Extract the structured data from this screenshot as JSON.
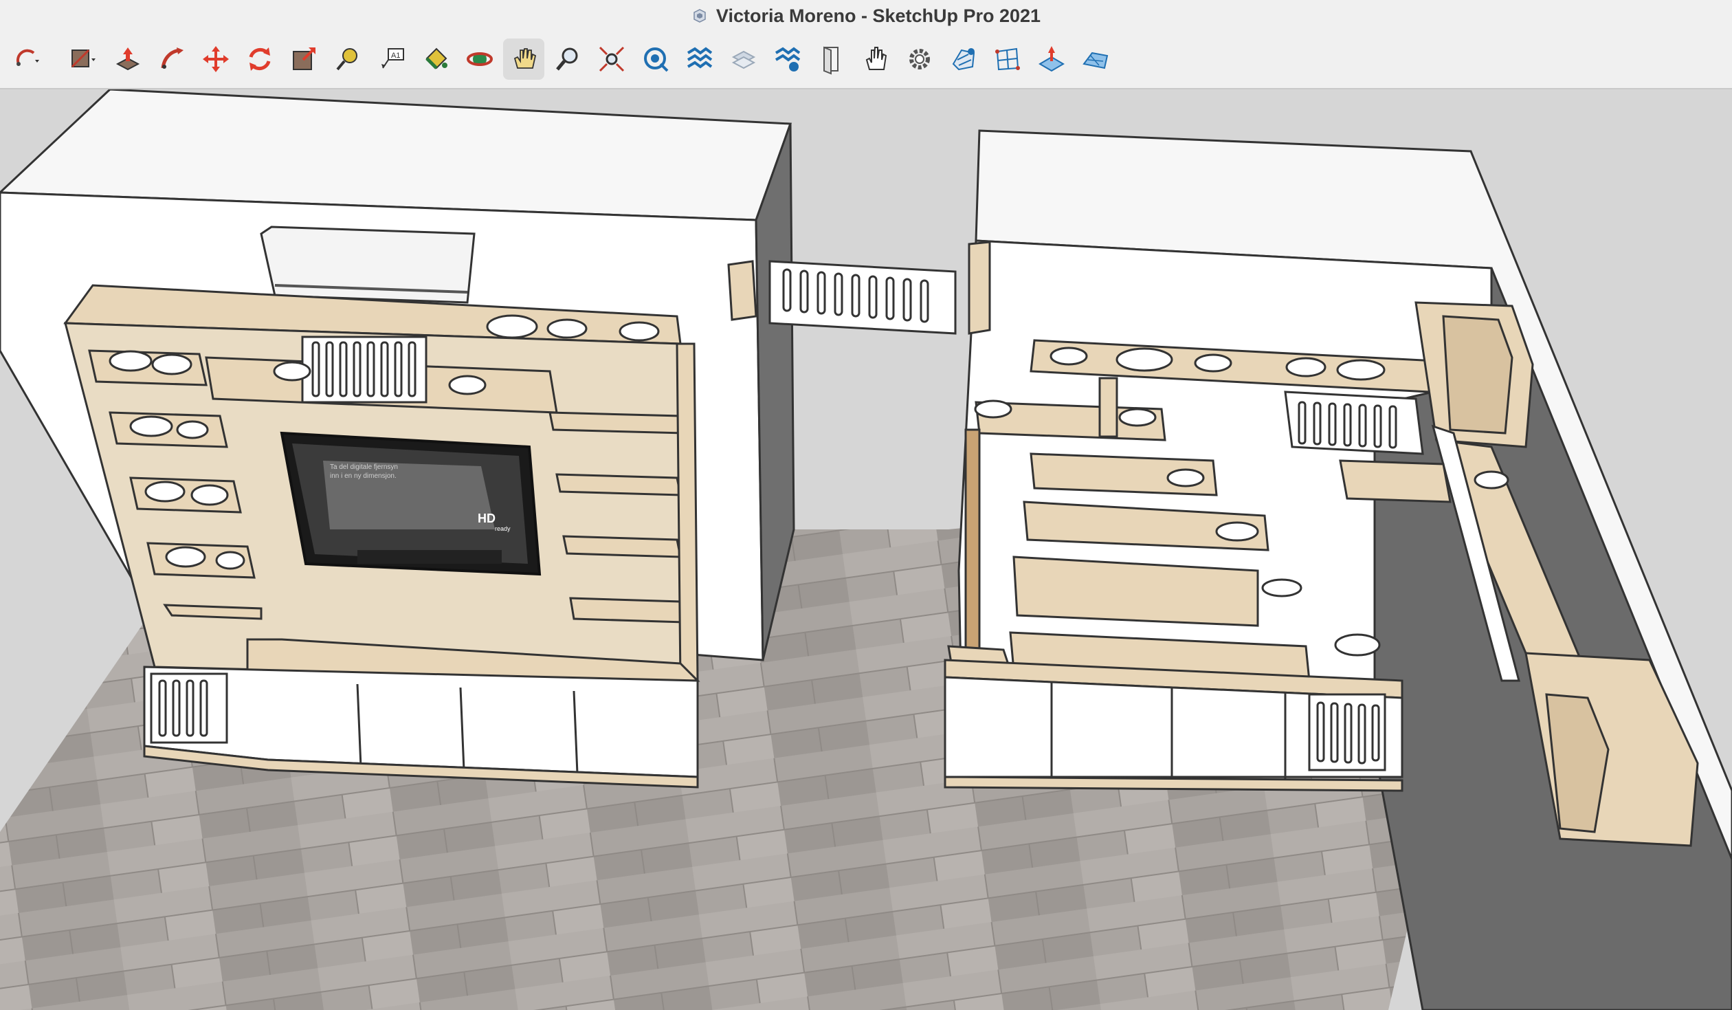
{
  "window": {
    "title": "Victoria Moreno - SketchUp Pro 2021"
  },
  "toolbar": {
    "tools": [
      {
        "name": "arc-icon",
        "label": "Arc"
      },
      {
        "name": "shape-icon",
        "label": "Shapes"
      },
      {
        "name": "push-pull-icon",
        "label": "Push/Pull"
      },
      {
        "name": "follow-me-icon",
        "label": "Follow Me"
      },
      {
        "name": "move-icon",
        "label": "Move"
      },
      {
        "name": "rotate-icon",
        "label": "Rotate"
      },
      {
        "name": "scale-icon",
        "label": "Scale"
      },
      {
        "name": "tape-measure-icon",
        "label": "Tape Measure"
      },
      {
        "name": "text-icon",
        "label": "Text"
      },
      {
        "name": "paint-bucket-icon",
        "label": "Paint Bucket"
      },
      {
        "name": "orbit-icon",
        "label": "Orbit"
      },
      {
        "name": "pan-icon",
        "label": "Pan"
      },
      {
        "name": "zoom-icon",
        "label": "Zoom"
      },
      {
        "name": "zoom-extents-icon",
        "label": "Zoom Extents"
      },
      {
        "name": "position-camera-icon",
        "label": "Position Camera"
      },
      {
        "name": "section-plane-icon",
        "label": "Section Plane"
      },
      {
        "name": "display-section-icon",
        "label": "Display Section Planes"
      },
      {
        "name": "section-fill-icon",
        "label": "Section Fill"
      },
      {
        "name": "door-icon",
        "label": "Component"
      },
      {
        "name": "hand-icon",
        "label": "Interact"
      },
      {
        "name": "gear-icon",
        "label": "Settings"
      },
      {
        "name": "sandbox-icon",
        "label": "Sandbox"
      },
      {
        "name": "grid-icon",
        "label": "Grid"
      },
      {
        "name": "smoove-icon",
        "label": "Smoove"
      },
      {
        "name": "terrain-icon",
        "label": "From Contours"
      }
    ],
    "active_tool": "Pan"
  },
  "scene": {
    "tv_screen_text": [
      "Ta del digitale fjernsyn",
      "inn i en ny dimensjon."
    ],
    "tv_badge": "HD",
    "tv_badge_sub": "ready",
    "colors": {
      "wall": "#ffffff",
      "wall_top": "#f7f7f7",
      "wall_side": "#6b6b6b",
      "floor": "#a8a39f",
      "plywood": "#e8d6b8",
      "plywood_edge": "#c9b38d",
      "background": "#d6d6d6"
    }
  }
}
